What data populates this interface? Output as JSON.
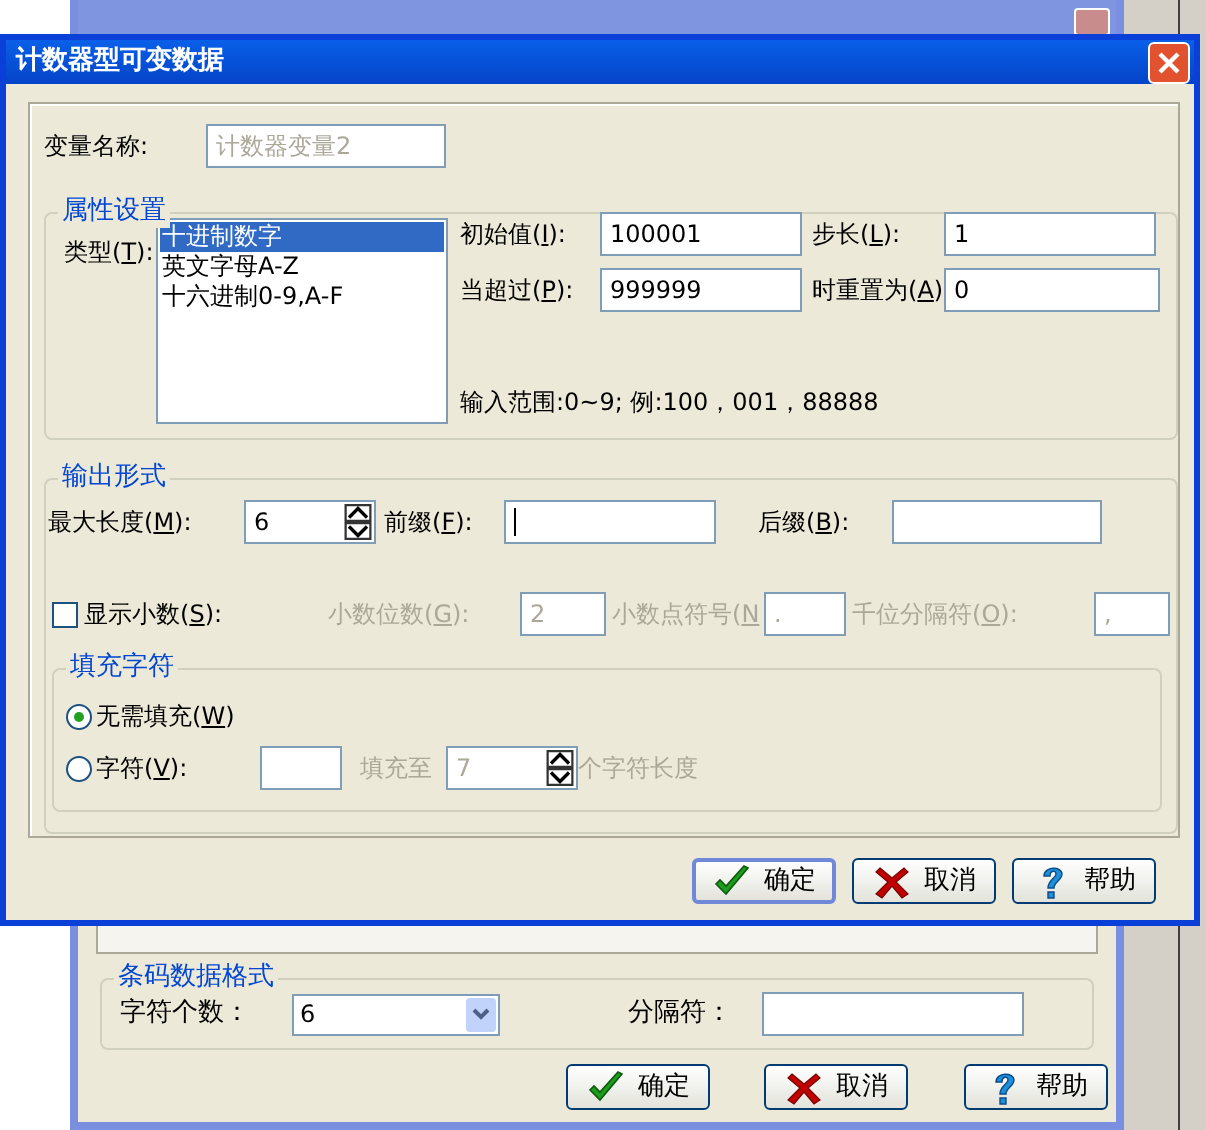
{
  "back_window": {
    "barcode_format": {
      "title": "条码数据格式",
      "char_count_label": "字符个数：",
      "char_count_value": "6",
      "separator_label": "分隔符："
    },
    "buttons": [
      {
        "kind": "ok",
        "label": "确定",
        "default": false
      },
      {
        "kind": "cancel",
        "label": "取消",
        "default": false
      },
      {
        "kind": "help",
        "label": "帮助",
        "default": false
      }
    ]
  },
  "dialog": {
    "title": "计数器型可变数据",
    "variable_name": {
      "label": "变量名称:",
      "value": "计数器变量2",
      "disabled": true
    },
    "properties": {
      "title": "属性设置",
      "type_label": "类型(T):",
      "types": [
        {
          "label": "十进制数字",
          "selected": true
        },
        {
          "label": "英文字母A-Z",
          "selected": false
        },
        {
          "label": "十六进制0-9,A-F",
          "selected": false
        }
      ],
      "start_label": "初始值(I):",
      "start_value": "100001",
      "step_label": "步长(L):",
      "step_value": "1",
      "exceed_label": "当超过(P):",
      "exceed_value": "999999",
      "reset_label": "时重置为(A)",
      "reset_value": "0",
      "hint": "输入范围:0~9; 例:100，001，88888"
    },
    "output": {
      "title": "输出形式",
      "max_length_label": "最大长度(M):",
      "max_length_value": "6",
      "prefix_label": "前缀(F):",
      "prefix_focused": true,
      "suffix_label": "后缀(B):",
      "show_decimal": {
        "label": "显示小数(S):",
        "checked": false
      },
      "decimal_fields": [
        {
          "label": "小数位数(G):",
          "value": "2",
          "disabled": true
        },
        {
          "label": "小数点符号(N",
          "value": ".",
          "disabled": true
        },
        {
          "label": "千位分隔符(O):",
          "value": ",",
          "disabled": true
        }
      ],
      "fill": {
        "title": "填充字符",
        "options": [
          {
            "kind": "none",
            "label": "无需填充(W)",
            "selected": true
          },
          {
            "kind": "char",
            "label": "字符(V):",
            "selected": false
          }
        ],
        "fill_to_label": "填充至",
        "fill_to_value": "7",
        "length_label": "个字符长度",
        "disabled": true
      }
    }
  },
  "buttons": [
    {
      "kind": "ok",
      "label": "确定",
      "default": true
    },
    {
      "kind": "cancel",
      "label": "取消",
      "default": false
    },
    {
      "kind": "help",
      "label": "帮助",
      "default": false
    }
  ]
}
